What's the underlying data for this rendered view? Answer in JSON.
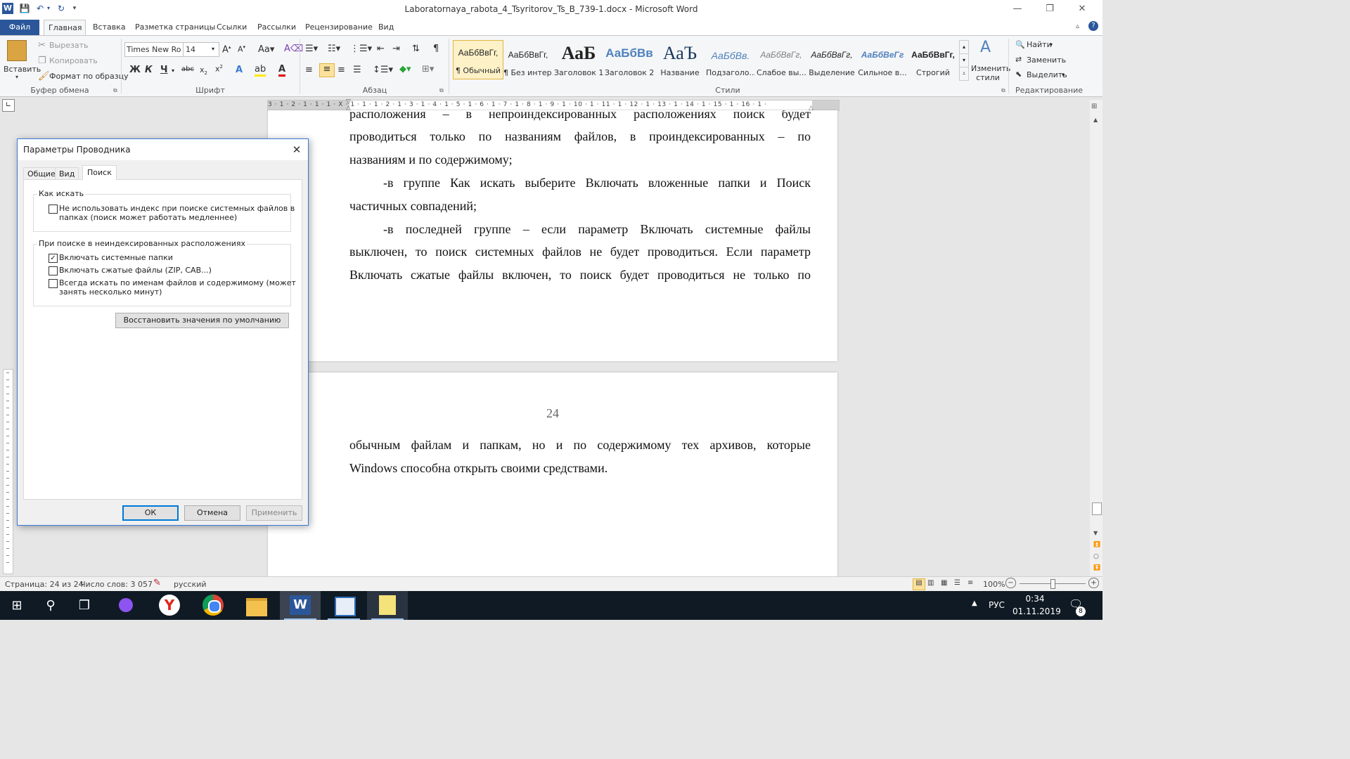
{
  "window": {
    "title": "Laboratornaya_rabota_4_Tsyritorov_Ts_B_739-1.docx  -  Microsoft Word",
    "minimize_glyph": "—",
    "restore_glyph": "❐",
    "close_glyph": "✕"
  },
  "ribbon_tabs": {
    "file": "Файл",
    "home": "Главная",
    "insert": "Вставка",
    "layout": "Разметка страницы",
    "links": "Ссылки",
    "mailings": "Рассылки",
    "review": "Рецензирование",
    "view": "Вид"
  },
  "clipboard": {
    "paste": "Вставить",
    "cut": "Вырезать",
    "copy": "Копировать",
    "format_painter": "Формат по образцу",
    "label": "Буфер обмена"
  },
  "font": {
    "family": "Times New Ro",
    "size": "14",
    "label": "Шрифт"
  },
  "paragraph": {
    "label": "Абзац"
  },
  "styles": {
    "label": "Стили",
    "items": [
      {
        "preview": "АаБбВвГг,",
        "name": "¶ Обычный"
      },
      {
        "preview": "АаБбВвГг,",
        "name": "¶ Без интер..."
      },
      {
        "preview": "АаБ",
        "name": "Заголовок 1"
      },
      {
        "preview": "АаБбВв",
        "name": "Заголовок 2"
      },
      {
        "preview": "АаЪ",
        "name": "Название"
      },
      {
        "preview": "АаБбВв.",
        "name": "Подзаголо..."
      },
      {
        "preview": "АаБбВвГг,",
        "name": "Слабое вы..."
      },
      {
        "preview": "АаБбВвГг,",
        "name": "Выделение"
      },
      {
        "preview": "АаБбВеГг",
        "name": "Сильное в..."
      },
      {
        "preview": "АаБбВвГг,",
        "name": "Строгий"
      }
    ],
    "change": "Изменить стили"
  },
  "editing": {
    "find": "Найти",
    "replace": "Заменить",
    "select": "Выделить",
    "label": "Редактирование"
  },
  "ruler": {
    "marks": "3 · 1 · 2 · 1 · 1 · 1 · X · 1 · 1 · 1 · 2 · 1 · 3 · 1 · 4 · 1 · 5 · 1 · 6 · 1 · 7 · 1 · 8 · 1 · 9 · 1 · 10 · 1 · 11 · 1 · 12 · 1 · 13 · 1 · 14 · 1 · 15 · 1 · 16 · 1 ·"
  },
  "document": {
    "page1_lines": [
      "расположения – в непроиндексированных расположениях поиск будет",
      "проводиться только по названиям файлов, в проиндексированных – по",
      "названиям и по содержимому;",
      "-в группе Как искать выберите Включать вложенные папки и Поиск",
      "частичных совпадений;",
      "-в последней группе – если параметр Включать системные файлы",
      "выключен, то поиск системных файлов не будет проводиться. Если параметр",
      "Включать сжатые файлы включен, то поиск будет проводиться не только по"
    ],
    "page_number": "24",
    "page2_lines": [
      "обычным файлам и папкам, но и по содержимому тех архивов, которые",
      "Windows способна открыть своими средствами."
    ]
  },
  "status": {
    "page": "Страница: 24 из 24",
    "words": "Число слов: 3 057",
    "language": "русский",
    "zoom": "100%"
  },
  "taskbar": {
    "language": "РУС",
    "time": "0:34",
    "date": "01.11.2019",
    "notifications": "8"
  },
  "dialog": {
    "title": "Параметры Проводника",
    "tabs": [
      "Общие",
      "Вид",
      "Поиск"
    ],
    "group1_title": "Как искать",
    "opt_no_index_line1": "Не использовать индекс при поиске системных файлов в",
    "opt_no_index_line2": "папках (поиск может работать медленнее)",
    "group2_title": "При поиске в неиндексированных расположениях",
    "opt_system_folders": "Включать системные папки",
    "opt_compressed": "Включать сжатые файлы (ZIP, CAB...)",
    "opt_always_line1": "Всегда искать по именам файлов и содержимому (может",
    "opt_always_line2": "занять несколько минут)",
    "restore_defaults": "Восстановить значения по умолчанию",
    "ok": "ОК",
    "cancel": "Отмена",
    "apply": "Применить"
  },
  "colors": {
    "accent": "#2b579a",
    "dialog_border": "#3c78d8",
    "taskbar": "#101a24"
  }
}
